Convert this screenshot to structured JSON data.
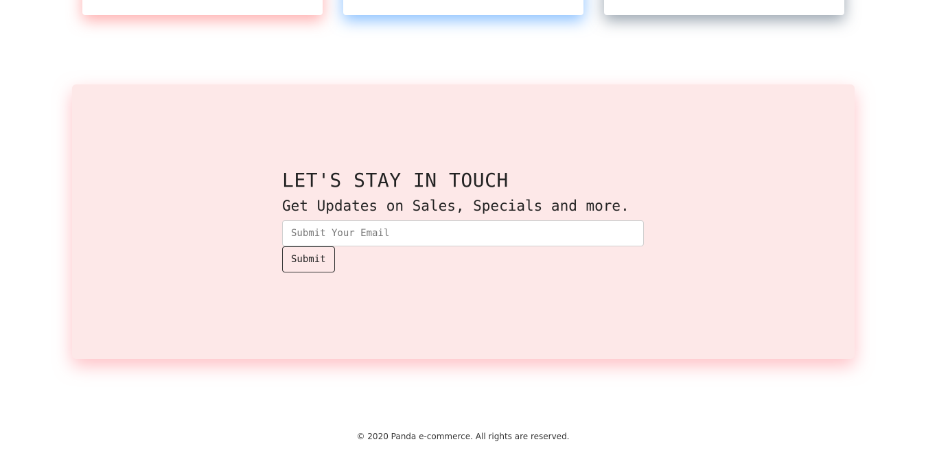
{
  "newsletter": {
    "title": "LET'S STAY IN TOUCH",
    "subtitle": "Get Updates on Sales, Specials and more.",
    "email_value": "",
    "email_placeholder": "Submit Your Email",
    "submit_label": "Submit"
  },
  "footer": {
    "copyright": "© 2020 Panda e-commerce. All rights are reserved."
  },
  "colors": {
    "newsletter_bg": "#fde8e8",
    "card_accent_red": "#c0394b",
    "card_shadow_blue": "#3c96ff"
  }
}
